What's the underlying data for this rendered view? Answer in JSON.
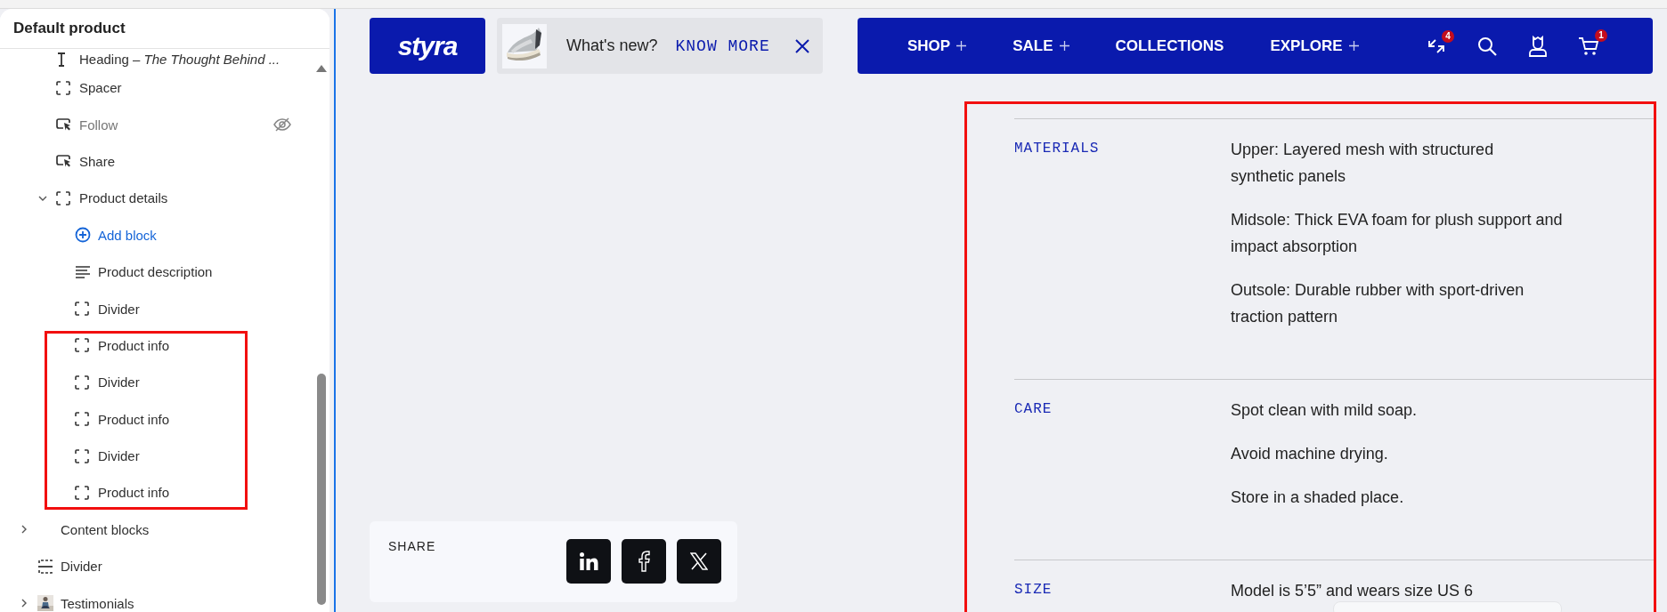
{
  "sidebar": {
    "title": "Default product",
    "continued_children": [
      {
        "kind": "text",
        "label": "Heading – *The Thought Behind ...*",
        "hidden": false,
        "highlighted": false
      },
      {
        "kind": "section",
        "label": "Spacer",
        "hidden": false,
        "highlighted": false
      },
      {
        "kind": "button",
        "label": "Follow",
        "hidden": true,
        "highlighted": false
      },
      {
        "kind": "button",
        "label": "Share",
        "hidden": false,
        "highlighted": false
      },
      {
        "kind": "section",
        "label": "Product details",
        "hidden": false,
        "highlighted": false,
        "expanded": true,
        "children": [
          {
            "kind": "add",
            "label": "Add block",
            "hidden": false,
            "highlighted": false
          },
          {
            "kind": "lines",
            "label": "Product description",
            "hidden": false,
            "highlighted": false
          },
          {
            "kind": "section",
            "label": "Divider",
            "hidden": false,
            "highlighted": false
          },
          {
            "kind": "section",
            "label": "Product info",
            "hidden": false,
            "highlighted": true
          },
          {
            "kind": "section",
            "label": "Divider",
            "hidden": false,
            "highlighted": true
          },
          {
            "kind": "section",
            "label": "Product info",
            "hidden": false,
            "highlighted": true
          },
          {
            "kind": "section",
            "label": "Divider",
            "hidden": false,
            "highlighted": true
          },
          {
            "kind": "section",
            "label": "Product info",
            "hidden": false,
            "highlighted": true
          }
        ]
      }
    ],
    "items": [
      {
        "kind": "none",
        "label": "Content blocks",
        "hidden": false,
        "highlighted": false,
        "expanded": false
      },
      {
        "kind": "divider",
        "label": "Divider",
        "hidden": false,
        "highlighted": false
      },
      {
        "label": "Testimonials",
        "hidden": false,
        "highlighted": false,
        "expanded": false
      }
    ]
  },
  "header": {
    "logo": "styra",
    "announcement": {
      "text": "What's new?",
      "link": "KNOW MORE"
    },
    "nav": [
      {
        "label": "SHOP",
        "plus": true
      },
      {
        "label": "SALE",
        "plus": true
      },
      {
        "label": "COLLECTIONS",
        "plus": false
      },
      {
        "label": "EXPLORE",
        "plus": true
      }
    ],
    "icons": [
      {
        "kind": "compare",
        "badge": "4"
      },
      {
        "kind": "search"
      },
      {
        "kind": "account"
      },
      {
        "kind": "cart",
        "badge": "1"
      }
    ]
  },
  "share": {
    "label": "SHARE",
    "buttons": [
      {
        "kind": "linkedin"
      },
      {
        "kind": "facebook"
      },
      {
        "kind": "x"
      }
    ]
  },
  "details": {
    "highlighted": true,
    "sections": [
      {
        "label": "MATERIALS",
        "paragraphs": [
          [
            "Upper: Layered mesh with structured",
            "synthetic panels"
          ],
          [
            "Midsole: Thick EVA foam for plush support and",
            "impact absorption"
          ],
          [
            "Outsole: Durable rubber with sport-driven",
            "traction pattern"
          ]
        ]
      },
      {
        "label": "CARE",
        "paragraphs": [
          [
            "Spot clean with mild soap."
          ],
          [
            "Avoid machine drying."
          ],
          [
            "Store in a shaded place."
          ]
        ]
      },
      {
        "label": "SIZE",
        "paragraphs": [
          [
            "Model is 5’5” and wears size US 6"
          ]
        ]
      }
    ]
  }
}
